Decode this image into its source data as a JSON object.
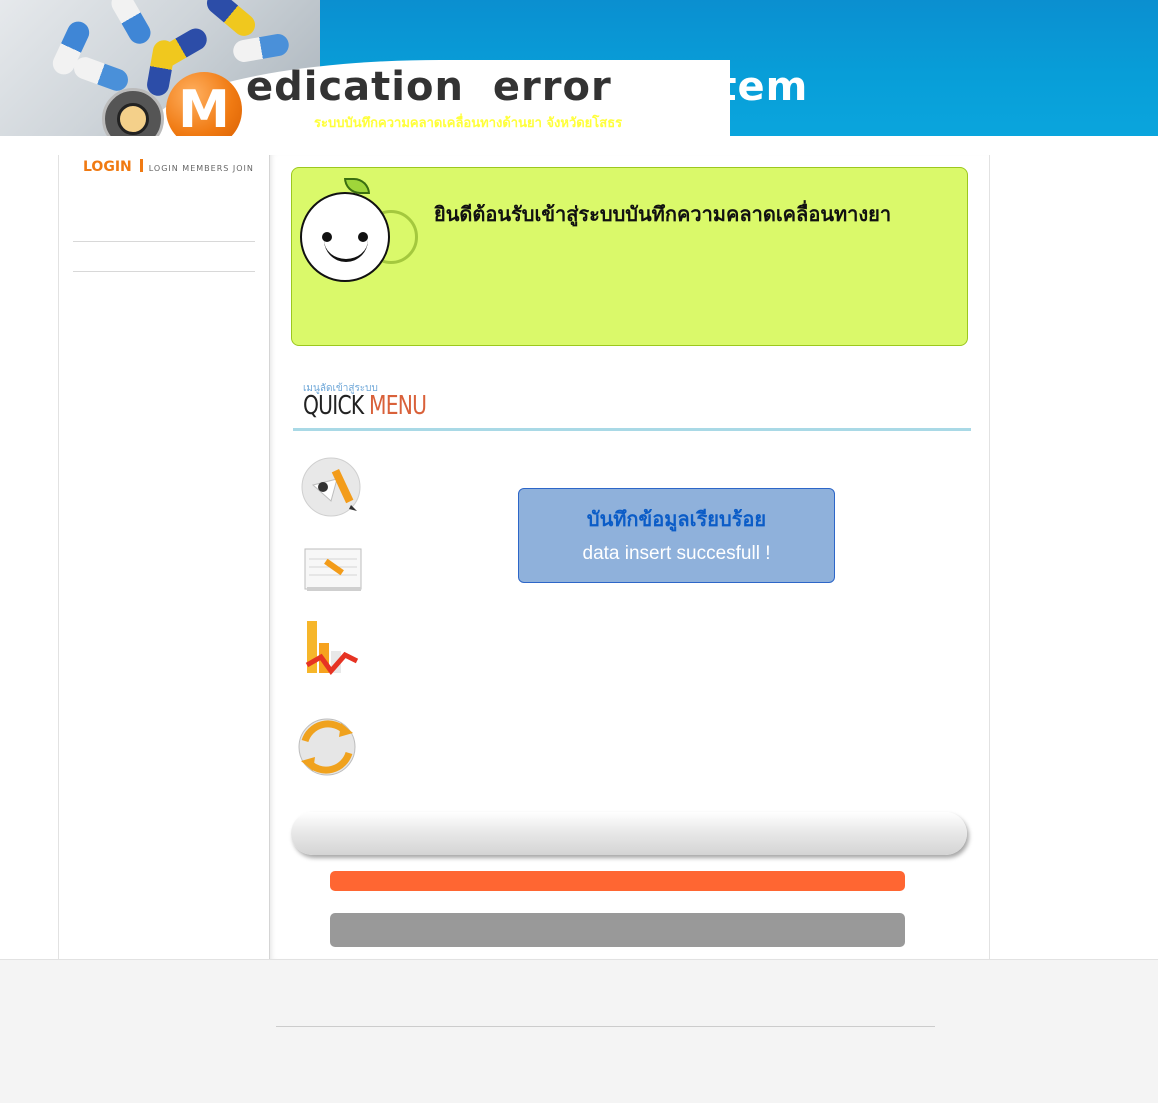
{
  "header": {
    "brand_part1": "edication",
    "brand_part2": "error",
    "brand_part3": "system",
    "logo_letter": "M",
    "subtitle": "ระบบบันทึกความคลาดเคลื่อนทางด้านยา  จังหวัดยโสธร"
  },
  "sidebar": {
    "login_title": "LOGIN",
    "login_subtitle": "LOGIN MEMBERS JOIN"
  },
  "welcome": {
    "text": "ยินดีต้อนรับเข้าสู่ระบบบันทึกความคลาดเคลื่อนทางยา"
  },
  "quick_menu": {
    "small_label": "เมนูลัดเข้าสู่ระบบ",
    "title_part1": "QUICK",
    "title_part2": "MENU",
    "icons": [
      "pencil-write-icon",
      "notepad-icon",
      "chart-icon",
      "refresh-icon"
    ]
  },
  "message": {
    "thai": "บันทึกข้อมูลเรียบร้อย",
    "english": "data insert succesfull !"
  },
  "colors": {
    "header_blue": "#089ed8",
    "accent_orange": "#f07a12",
    "welcome_green": "#daf96a",
    "message_blue": "#8fb1db",
    "bar_orange": "#ff6632",
    "bar_gray": "#999999"
  }
}
